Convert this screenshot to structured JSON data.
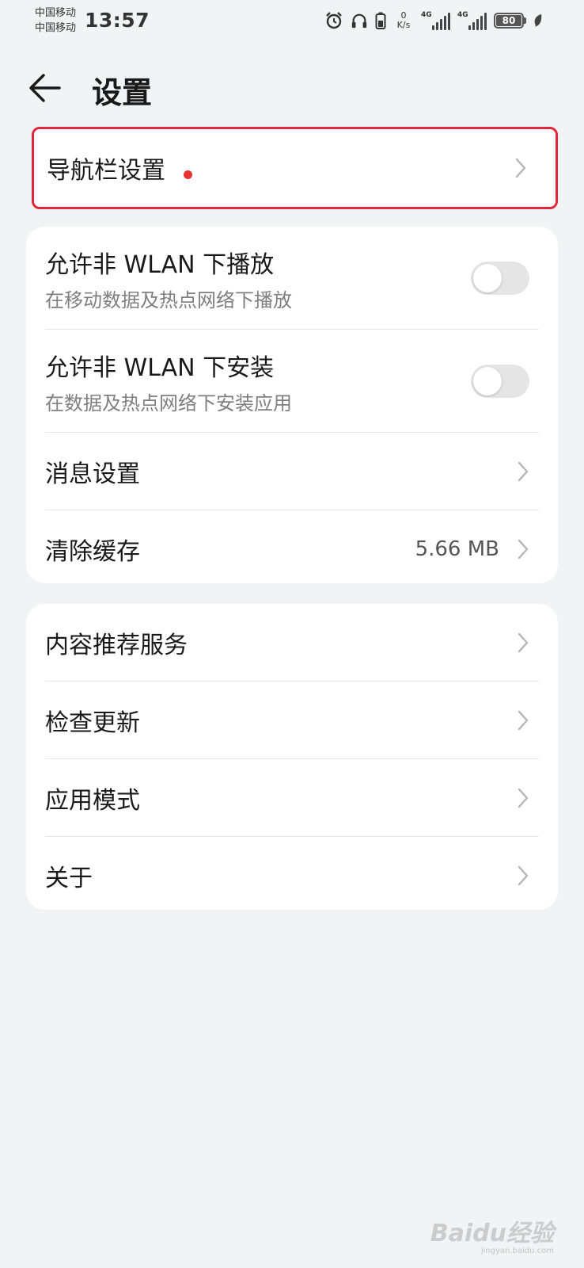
{
  "status_bar": {
    "carrier_1": "中国移动",
    "carrier_2": "中国移动",
    "time": "13:57",
    "net_speed_value": "0",
    "net_speed_unit": "K/s",
    "signal_1_tag": "4G",
    "signal_2_tag": "4G",
    "battery_level": "80",
    "icons": [
      "alarm-icon",
      "headphones-icon",
      "battery-saver-icon",
      "signal-icon",
      "signal-icon",
      "battery-icon",
      "leaf-icon"
    ]
  },
  "header": {
    "back_icon": "arrow-left-icon",
    "title": "设置"
  },
  "nav_section": {
    "label": "导航栏设置",
    "has_red_dot": true
  },
  "section_1": {
    "items": [
      {
        "label": "允许非 WLAN 下播放",
        "sub": "在移动数据及热点网络下播放",
        "toggle": false
      },
      {
        "label": "允许非 WLAN 下安装",
        "sub": "在数据及热点网络下安装应用",
        "toggle": false
      },
      {
        "label": "消息设置"
      },
      {
        "label": "清除缓存",
        "value": "5.66 MB"
      }
    ]
  },
  "section_2": {
    "items": [
      {
        "label": "内容推荐服务"
      },
      {
        "label": "检查更新"
      },
      {
        "label": "应用模式"
      },
      {
        "label": "关于"
      }
    ]
  },
  "watermark": {
    "logo": "Baidu经验",
    "url": "jingyan.baidu.com"
  },
  "colors": {
    "background": "#f1f3f5",
    "card": "#ffffff",
    "highlight_border": "#e0283a",
    "red_dot": "#e8342e",
    "toggle_off": "#e5e5e5"
  }
}
